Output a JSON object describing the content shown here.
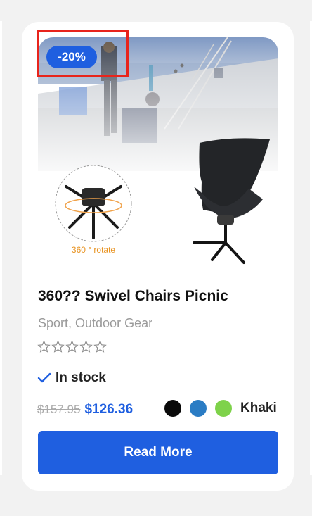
{
  "product": {
    "discount_badge": "-20%",
    "title": "360?? Swivel Chairs Picnic",
    "category": "Sport, Outdoor Gear",
    "rating_stars": 0,
    "rating_max": 5,
    "stock_status": "In stock",
    "old_price": "$157.95",
    "new_price": "$126.36",
    "rotate_caption": "360 ° rotate",
    "swatches": [
      {
        "name": "black-swatch",
        "color": "#0a0a0a"
      },
      {
        "name": "blue-swatch",
        "color": "#2a7cc4"
      },
      {
        "name": "green-swatch",
        "color": "#7ed24a"
      }
    ],
    "swatch_label": "Khaki",
    "button_label": "Read More"
  },
  "colors": {
    "accent": "#1f5fe0",
    "highlight_outline": "#e8241c"
  }
}
